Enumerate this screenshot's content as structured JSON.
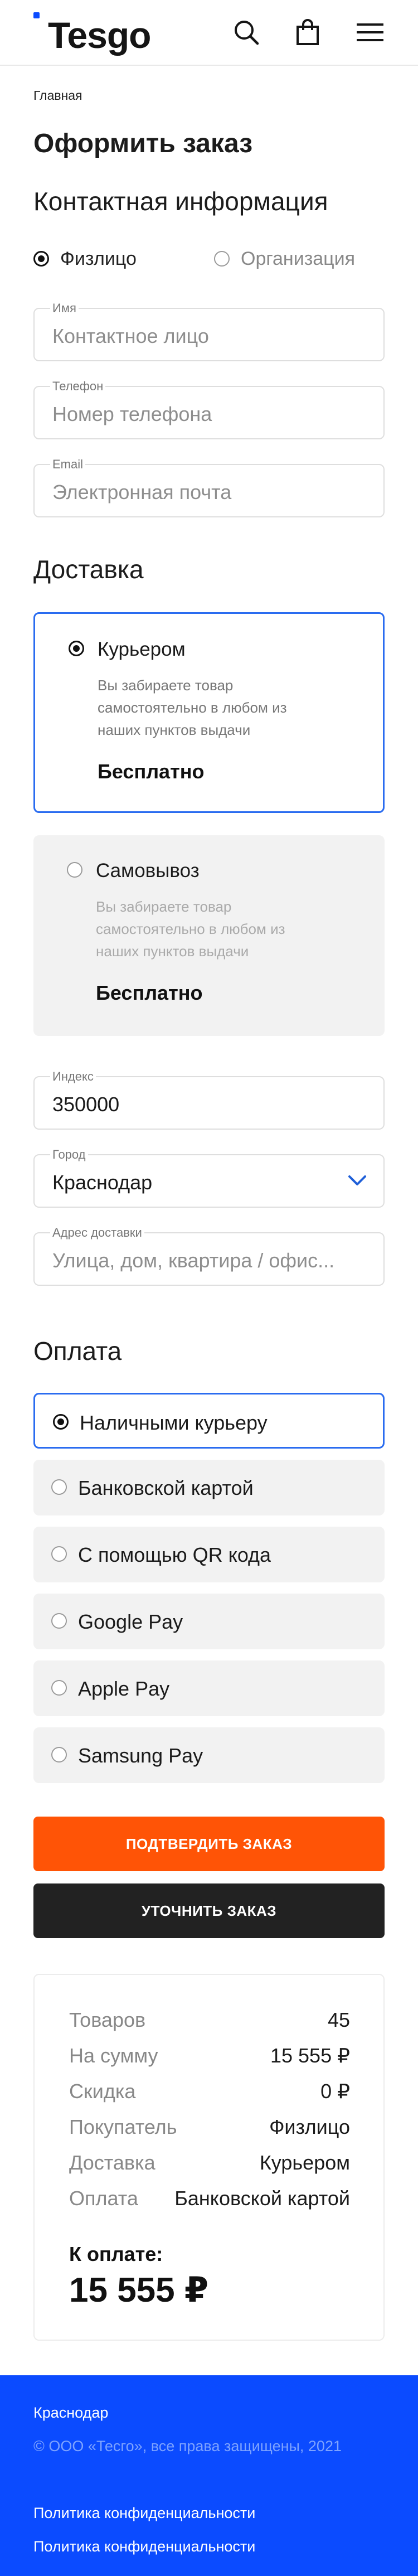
{
  "header": {
    "logo_text": "Tesgo",
    "icons": [
      "search-icon",
      "shopping-bag-icon",
      "menu-icon"
    ]
  },
  "breadcrumb": "Главная",
  "page_title": "Оформить заказ",
  "contact": {
    "title": "Контактная информация",
    "person_type": {
      "individual": "Физлицо",
      "organization": "Организация",
      "selected": "individual"
    },
    "name": {
      "label": "Имя",
      "placeholder": "Контактное лицо"
    },
    "phone": {
      "label": "Телефон",
      "placeholder": "Номер телефона"
    },
    "email": {
      "label": "Email",
      "placeholder": "Электронная почта"
    }
  },
  "delivery": {
    "title": "Доставка",
    "options": [
      {
        "title": "Курьером",
        "description": "Вы забираете товар самостоятельно в любом из наших пунктов выдачи",
        "price": "Бесплатно",
        "selected": true
      },
      {
        "title": "Самовывоз",
        "description": "Вы забираете товар самостоятельно в любом из наших пунктов выдачи",
        "price": "Бесплатно",
        "selected": false
      }
    ],
    "index": {
      "label": "Индекс",
      "value": "350000"
    },
    "city": {
      "label": "Город",
      "value": "Краснодар"
    },
    "address": {
      "label": "Адрес доставки",
      "placeholder": "Улица, дом, квартира / офис..."
    }
  },
  "payment": {
    "title": "Оплата",
    "options": [
      {
        "label": "Наличными курьеру",
        "selected": true
      },
      {
        "label": "Банковской картой",
        "selected": false
      },
      {
        "label": "С помощью QR кода",
        "selected": false
      },
      {
        "label": "Google Pay",
        "selected": false
      },
      {
        "label": "Apple Pay",
        "selected": false
      },
      {
        "label": "Samsung Pay",
        "selected": false
      }
    ]
  },
  "buttons": {
    "confirm": "ПОДТВЕРДИТЬ ЗАКАЗ",
    "clarify": "УТОЧНИТЬ ЗАКАЗ"
  },
  "summary": {
    "rows": [
      {
        "key": "Товаров",
        "value": "45"
      },
      {
        "key": "На сумму",
        "value": "15 555 ₽"
      },
      {
        "key": "Скидка",
        "value": "0 ₽"
      },
      {
        "key": "Покупатель",
        "value": "Физлицо"
      },
      {
        "key": "Доставка",
        "value": "Курьером"
      },
      {
        "key": "Оплата",
        "value": "Банковской картой"
      }
    ],
    "pay_label": "К оплате:",
    "total": "15 555 ₽"
  },
  "footer": {
    "city": "Краснодар",
    "copyright": "© ООО «Тесго», все права защищены, 2021",
    "links": [
      "Политика конфиденциальности",
      "Политика конфиденциальности"
    ]
  },
  "colors": {
    "brand_blue": "#0b4bff",
    "accent_orange": "#ff5406",
    "selected_border": "#2a6cf0",
    "dark_button": "#222222"
  }
}
